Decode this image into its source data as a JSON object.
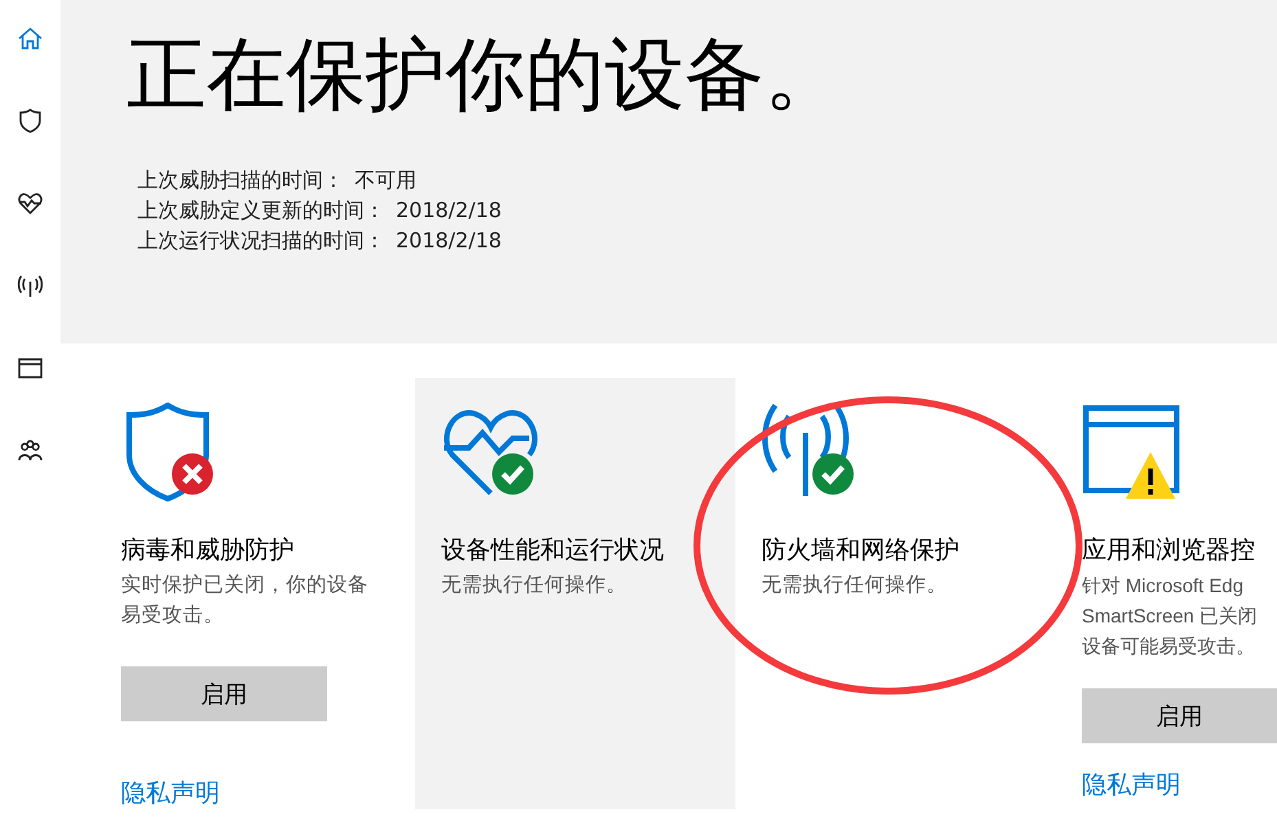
{
  "sidebar": {
    "items": [
      {
        "kind": "home",
        "selected": true
      },
      {
        "kind": "shield",
        "selected": false
      },
      {
        "kind": "heart",
        "selected": false
      },
      {
        "kind": "antenna",
        "selected": false
      },
      {
        "kind": "browser",
        "selected": false
      },
      {
        "kind": "family",
        "selected": false
      }
    ]
  },
  "header": {
    "title": "正在保护你的设备。",
    "info": [
      {
        "label": "上次威胁扫描的时间：",
        "value": "不可用"
      },
      {
        "label": "上次威胁定义更新的时间：",
        "value": "2018/2/18"
      },
      {
        "label": "上次运行状况扫描的时间：",
        "value": "2018/2/18"
      }
    ]
  },
  "cards": [
    {
      "kind": "shield-error",
      "selected": false,
      "title": "病毒和威胁防护",
      "description_lines": [
        "实时保护已关闭，你的设备",
        "易受攻击。"
      ],
      "button": "启用",
      "link": "隐私声明"
    },
    {
      "kind": "heart-ok",
      "selected": true,
      "title": "设备性能和运行状况",
      "description_lines": [
        "无需执行任何操作。"
      ]
    },
    {
      "kind": "antenna-ok",
      "selected": false,
      "title": "防火墙和网络保护",
      "description_lines": [
        "无需执行任何操作。"
      ]
    },
    {
      "kind": "browser-warning",
      "selected": false,
      "title": "应用和浏览器控",
      "description_lines": [
        "针对 Microsoft Edg",
        "SmartScreen 已关闭",
        "设备可能易受攻击。"
      ],
      "button": "启用",
      "link": "隐私声明"
    }
  ]
}
